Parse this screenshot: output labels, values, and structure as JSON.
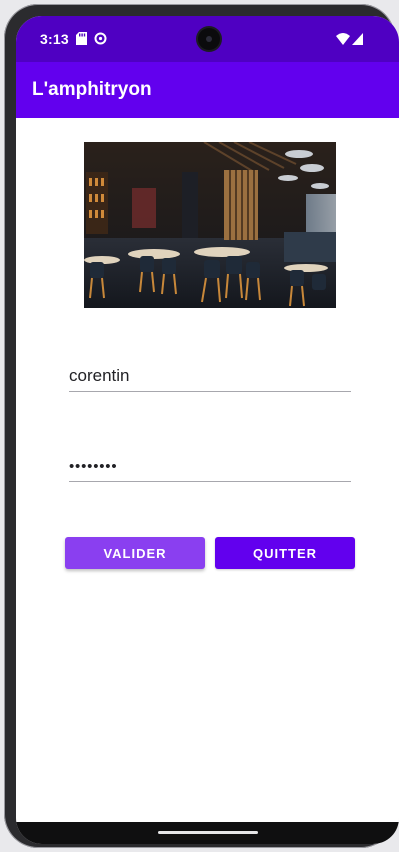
{
  "status_bar": {
    "time": "3:13",
    "icons_left": [
      "sd-card-icon",
      "sync-icon"
    ],
    "icons_right": [
      "wifi-icon",
      "signal-icon"
    ]
  },
  "app_bar": {
    "title": "L'amphitryon"
  },
  "hero_image": {
    "description_icon": "restaurant-photo"
  },
  "form": {
    "username_value": "corentin",
    "password_value": "••••••••"
  },
  "buttons": {
    "valider_label": "VALIDER",
    "quitter_label": "QUITTER"
  },
  "colors": {
    "status_bar": "#4f00c2",
    "app_bar": "#6200ee",
    "valider_button": "#8a3ff0",
    "quitter_button": "#6200ee"
  }
}
